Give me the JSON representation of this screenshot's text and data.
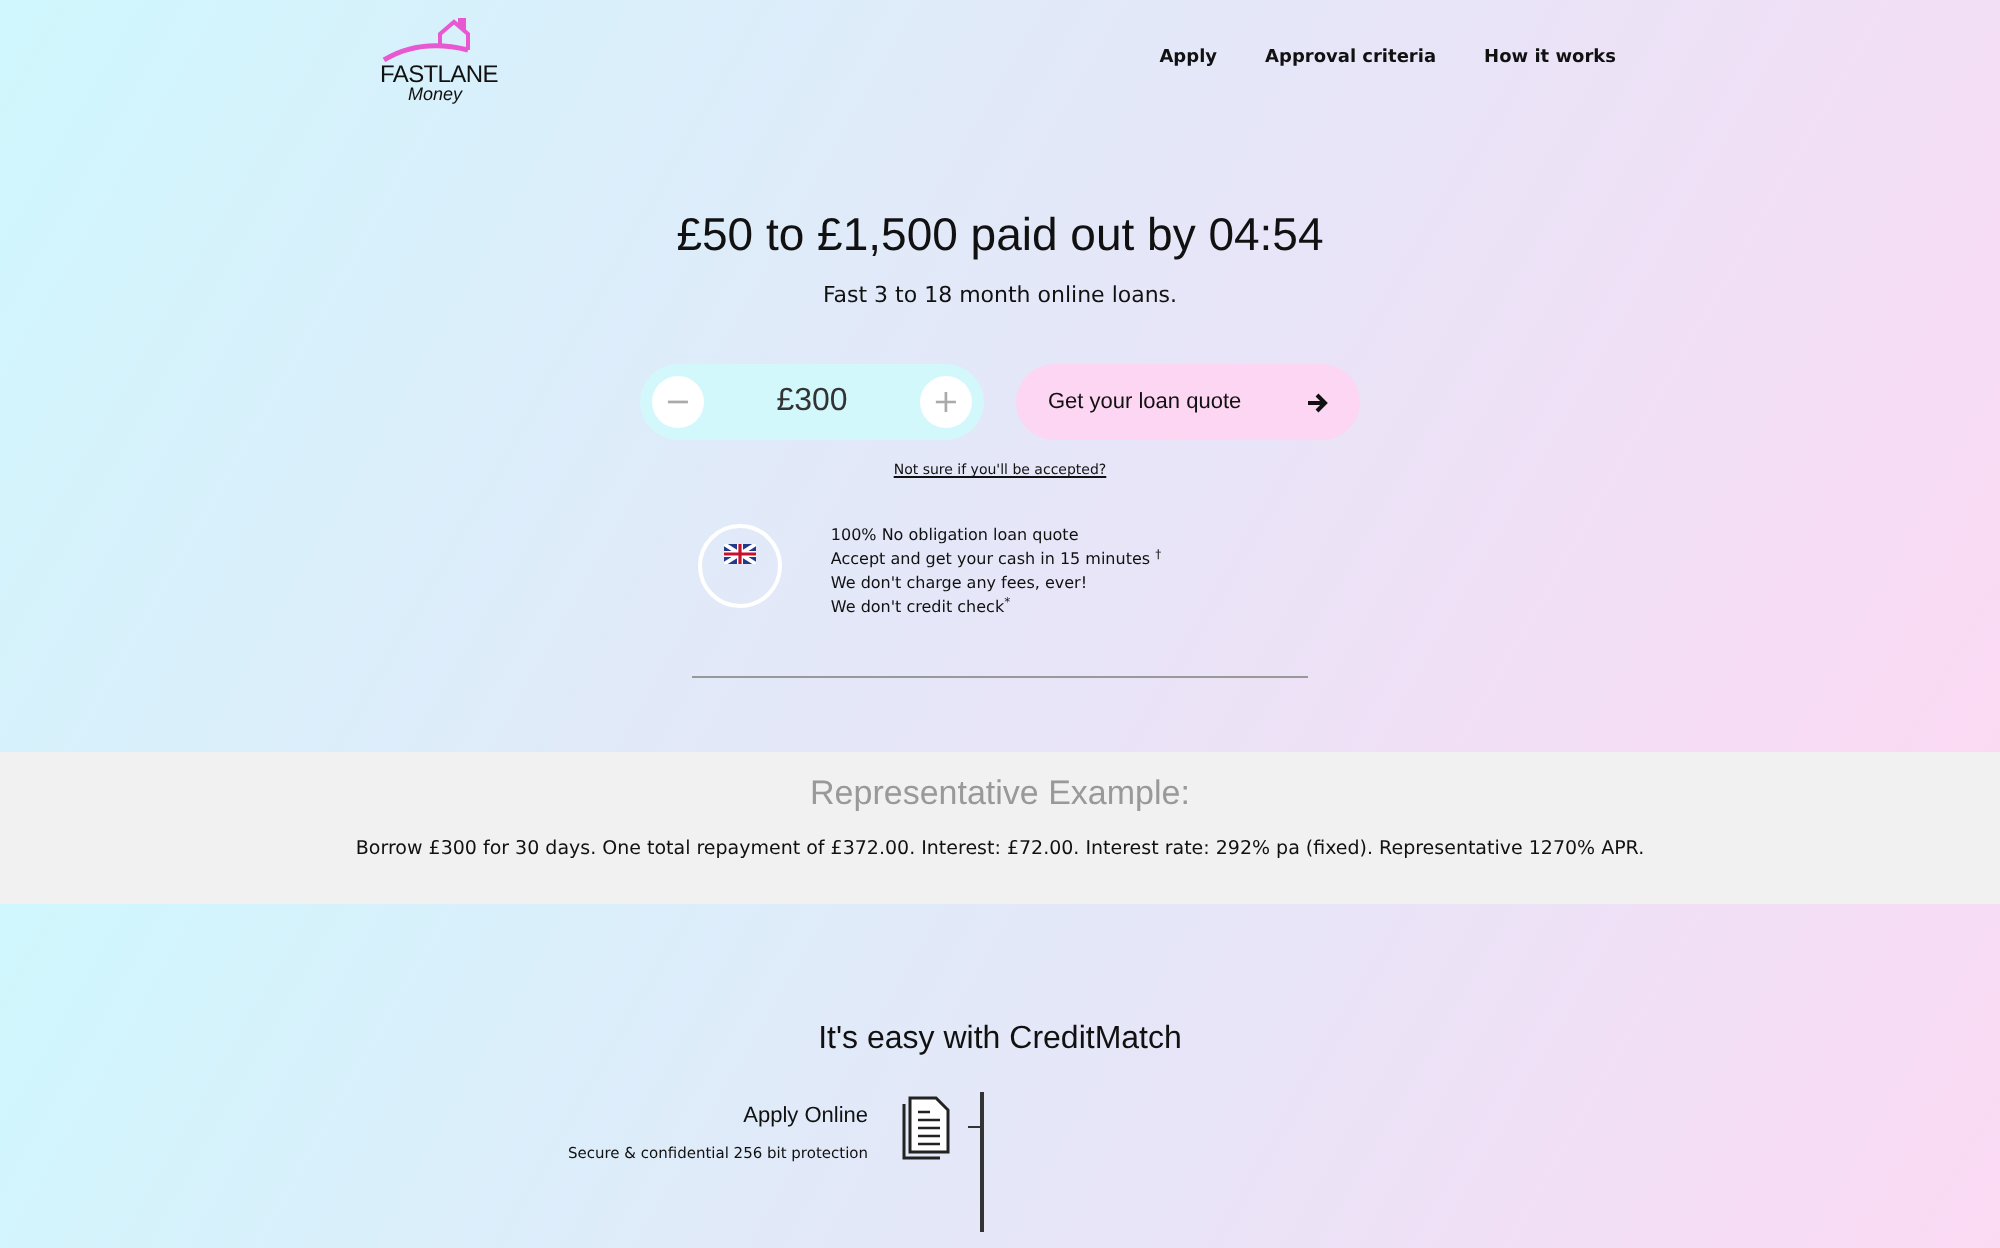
{
  "logo": {
    "name": "FASTLANE",
    "tagline": "Money"
  },
  "nav": [
    {
      "label": "Apply"
    },
    {
      "label": "Approval criteria"
    },
    {
      "label": "How it works"
    }
  ],
  "hero": {
    "headline": "£50 to £1,500 paid out by 04:54",
    "subtitle": "Fast 3 to 18 month online loans.",
    "amount": "£300",
    "minus": "−",
    "plus": "+",
    "quote_button": "Get your loan quote",
    "eligibility_link": "Not sure if you'll be accepted?"
  },
  "features": [
    "100% No obligation loan quote",
    "Accept and get your cash in 15 minutes $^{†}$",
    "We don't charge any fees, ever!",
    "We don't credit check$^{*}$"
  ],
  "example": {
    "title": "Representative Example:",
    "text": "Borrow £300 for 30 days. One total repayment of £372.00. Interest: £72.00. Interest rate: 292% pa (fixed). Representative 1270% APR."
  },
  "how": {
    "title": "It's easy with CreditMatch",
    "steps": [
      {
        "title": "Apply Online",
        "text": "Secure & confidential 256 bit protection"
      }
    ]
  }
}
